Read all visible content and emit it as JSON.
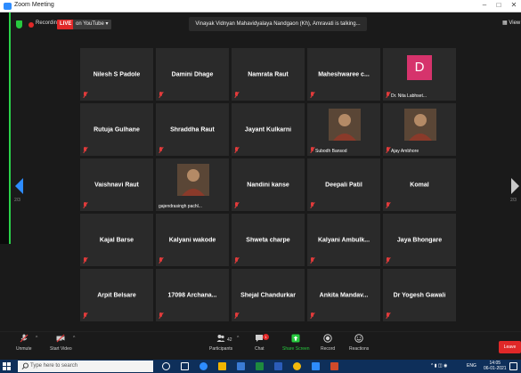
{
  "window": {
    "title": "Zoom Meeting",
    "controls": [
      "–",
      "□",
      "✕"
    ]
  },
  "topbar": {
    "recording_label": "Recording",
    "live_badge": "LIVE",
    "stream_label": "on YouTube ▾",
    "talking_text": "Vinayak Vidnyan Mahavidyalaya Nandgaon (Kh), Amravati is talking...",
    "view_label": "View"
  },
  "pagination": {
    "left": "2/3",
    "right": "2/3"
  },
  "participants": [
    {
      "name": "Nilesh S Padole",
      "muted": true
    },
    {
      "name": "Damini Dhage",
      "muted": true
    },
    {
      "name": "Namrata Raut",
      "muted": true
    },
    {
      "name": "Maheshwaree c...",
      "muted": true
    },
    {
      "name": "",
      "label": "Dr. Nita Labhset...",
      "avatar_letter": "D",
      "muted": true
    },
    {
      "name": "Rutuja Gulhane",
      "muted": true
    },
    {
      "name": "Shraddha Raut",
      "muted": true
    },
    {
      "name": "Jayant Kulkarni",
      "muted": true
    },
    {
      "name": "",
      "label": "Subodh Bansod",
      "photo": true,
      "muted": true
    },
    {
      "name": "",
      "label": "Ajay Ambhore",
      "photo": true,
      "muted": true
    },
    {
      "name": "Vaishnavi Raut",
      "muted": true
    },
    {
      "name": "",
      "label": "gajendrasingh pachl...",
      "photo": true,
      "muted": false
    },
    {
      "name": "Nandini kanse",
      "muted": true
    },
    {
      "name": "Deepali Patil",
      "muted": true
    },
    {
      "name": "Komal",
      "muted": true
    },
    {
      "name": "Kajal Barse",
      "muted": true
    },
    {
      "name": "Kalyani wakode",
      "muted": true
    },
    {
      "name": "Shweta charpe",
      "muted": true
    },
    {
      "name": "Kalyani  Ambulk...",
      "muted": true
    },
    {
      "name": "Jaya Bhongare",
      "muted": true
    },
    {
      "name": "Arpit Belsare",
      "muted": true
    },
    {
      "name": "17098 Archana...",
      "muted": true
    },
    {
      "name": "Shejal Chandurkar",
      "muted": true
    },
    {
      "name": "Ankita  Mandav...",
      "muted": true
    },
    {
      "name": "Dr Yogesh Gawali",
      "muted": true
    }
  ],
  "toolbar": {
    "unmute": "Unmute",
    "start_video": "Start Video",
    "participants": "Participants",
    "participants_count": "42",
    "chat": "Chat",
    "chat_badge": "1",
    "share_screen": "Share Screen",
    "record": "Record",
    "reactions": "Reactions",
    "leave": "Leave",
    "share_color": "#27c93f"
  },
  "taskbar": {
    "search_placeholder": "Type here to search",
    "tray_lang": "ENG",
    "time": "14:05",
    "date": "06-01-2021"
  }
}
